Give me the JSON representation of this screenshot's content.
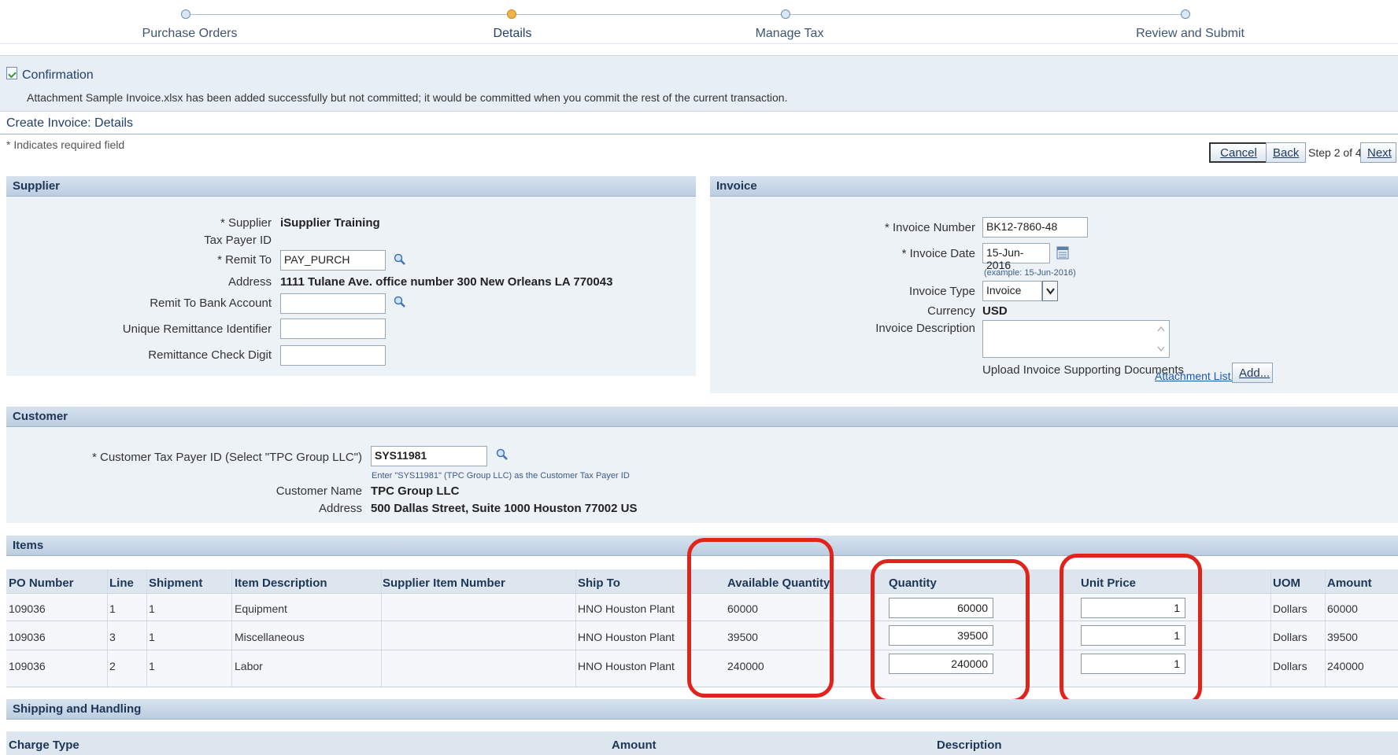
{
  "train": {
    "steps": [
      {
        "label": "Purchase Orders"
      },
      {
        "label": "Details"
      },
      {
        "label": "Manage Tax"
      },
      {
        "label": "Review and Submit"
      }
    ]
  },
  "confirmation": {
    "title": "Confirmation",
    "message": "Attachment Sample Invoice.xlsx has been added successfully but not committed; it would be committed when you commit the rest of the current transaction."
  },
  "page": {
    "title": "Create Invoice: Details",
    "required_note": "* Indicates required field"
  },
  "actions": {
    "cancel": "Cancel",
    "back": "Back",
    "step_text": "Step 2 of 4",
    "next": "Next"
  },
  "supplier": {
    "header": "Supplier",
    "supplier_label": "* Supplier",
    "supplier_value": "iSupplier Training",
    "tax_payer_label": "Tax Payer ID",
    "remit_to_label": "* Remit To",
    "remit_to_value": "PAY_PURCH",
    "address_label": "Address",
    "address_value": "1111 Tulane Ave. office number 300 New Orleans LA 770043",
    "bank_account_label": "Remit To Bank Account",
    "unique_remit_label": "Unique Remittance Identifier",
    "check_digit_label": "Remittance Check Digit"
  },
  "invoice": {
    "header": "Invoice",
    "number_label": "* Invoice Number",
    "number_value": "BK12-7860-48",
    "date_label": "* Invoice Date",
    "date_value": "15-Jun-2016",
    "date_hint": "(example: 15-Jun-2016)",
    "type_label": "Invoice Type",
    "type_value": "Invoice",
    "currency_label": "Currency",
    "currency_value": "USD",
    "description_label": "Invoice Description",
    "upload_label": "Upload Invoice Supporting Documents",
    "attachment_link": "Attachment List...",
    "add_button": "Add..."
  },
  "customer": {
    "header": "Customer",
    "tax_payer_label": "* Customer Tax Payer ID (Select \"TPC Group LLC\")",
    "tax_payer_value": "SYS11981",
    "tax_payer_hint": "Enter \"SYS11981\" (TPC Group LLC) as the Customer Tax Payer ID",
    "name_label": "Customer Name",
    "name_value": "TPC Group LLC",
    "address_label": "Address",
    "address_value": "500 Dallas Street, Suite 1000 Houston 77002 US"
  },
  "items": {
    "header": "Items",
    "columns": {
      "po_number": "PO Number",
      "line": "Line",
      "shipment": "Shipment",
      "item_description": "Item Description",
      "supplier_item_number": "Supplier Item Number",
      "ship_to": "Ship To",
      "available_quantity": "Available Quantity",
      "quantity": "Quantity",
      "unit_price": "Unit Price",
      "uom": "UOM",
      "amount": "Amount"
    },
    "rows": [
      {
        "po": "109036",
        "line": "1",
        "shipment": "1",
        "desc": "Equipment",
        "ship_to": "HNO Houston Plant",
        "available": "60000",
        "quantity": "60000",
        "unit_price": "1",
        "uom": "Dollars",
        "amount": "60000"
      },
      {
        "po": "109036",
        "line": "3",
        "shipment": "1",
        "desc": "Miscellaneous",
        "ship_to": "HNO Houston Plant",
        "available": "39500",
        "quantity": "39500",
        "unit_price": "1",
        "uom": "Dollars",
        "amount": "39500"
      },
      {
        "po": "109036",
        "line": "2",
        "shipment": "1",
        "desc": "Labor",
        "ship_to": "HNO Houston Plant",
        "available": "240000",
        "quantity": "240000",
        "unit_price": "1",
        "uom": "Dollars",
        "amount": "240000"
      }
    ]
  },
  "shipping": {
    "header": "Shipping and Handling",
    "col_charge_type": "Charge Type",
    "col_amount": "Amount",
    "col_description": "Description"
  },
  "colors": {
    "highlight": "#e0241b",
    "section_header": "#bccde0",
    "link": "#1a56b3"
  }
}
